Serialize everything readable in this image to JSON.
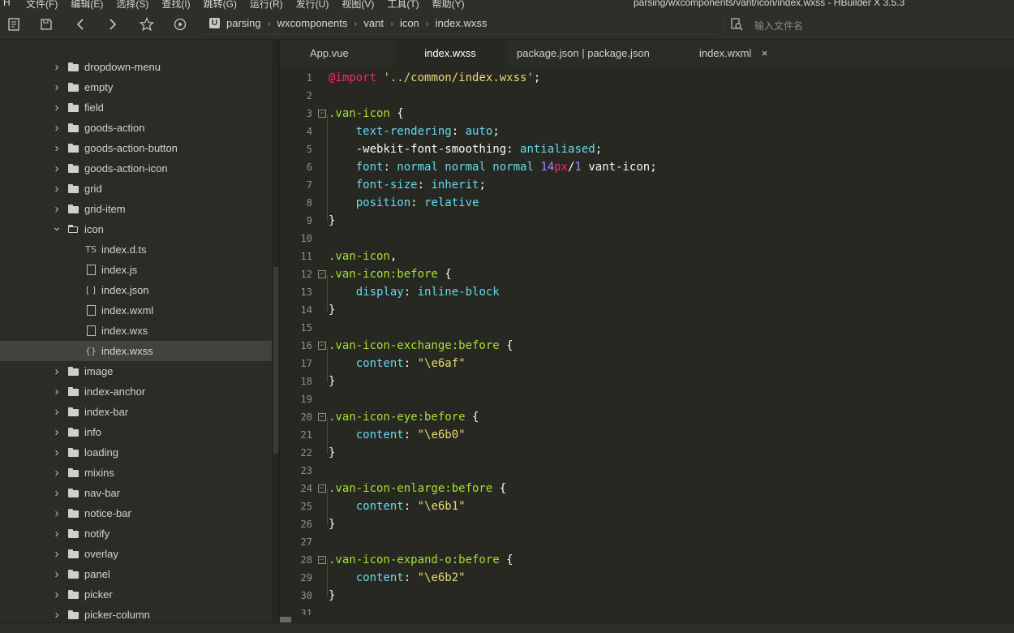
{
  "app": {
    "logo": "H",
    "window_title": "parsing/wxcomponents/vant/icon/index.wxss - HBuilder X 3.5.3",
    "menus": [
      "文件(F)",
      "编辑(E)",
      "选择(S)",
      "查找(I)",
      "跳转(G)",
      "运行(R)",
      "发行(U)",
      "视图(V)",
      "工具(T)",
      "帮助(Y)"
    ]
  },
  "toolbar": {
    "icons": [
      "new-file-icon",
      "save-icon",
      "back-icon",
      "forward-icon",
      "star-icon",
      "run-icon"
    ],
    "breadcrumb_badge": "U",
    "breadcrumb": [
      "parsing",
      "wxcomponents",
      "vant",
      "icon",
      "index.wxss"
    ],
    "search_placeholder": "输入文件名"
  },
  "sidebar": {
    "items": [
      {
        "label": "dropdown-menu",
        "kind": "folder"
      },
      {
        "label": "empty",
        "kind": "folder"
      },
      {
        "label": "field",
        "kind": "folder"
      },
      {
        "label": "goods-action",
        "kind": "folder"
      },
      {
        "label": "goods-action-button",
        "kind": "folder"
      },
      {
        "label": "goods-action-icon",
        "kind": "folder"
      },
      {
        "label": "grid",
        "kind": "folder"
      },
      {
        "label": "grid-item",
        "kind": "folder"
      },
      {
        "label": "icon",
        "kind": "folder-open"
      },
      {
        "label": "index.d.ts",
        "kind": "file",
        "icon": "TS"
      },
      {
        "label": "index.js",
        "kind": "file",
        "icon": "js"
      },
      {
        "label": "index.json",
        "kind": "file",
        "icon": "[ ]"
      },
      {
        "label": "index.wxml",
        "kind": "file",
        "icon": "doc"
      },
      {
        "label": "index.wxs",
        "kind": "file",
        "icon": "doc"
      },
      {
        "label": "index.wxss",
        "kind": "file",
        "icon": "{}",
        "selected": true
      },
      {
        "label": "image",
        "kind": "folder"
      },
      {
        "label": "index-anchor",
        "kind": "folder"
      },
      {
        "label": "index-bar",
        "kind": "folder"
      },
      {
        "label": "info",
        "kind": "folder"
      },
      {
        "label": "loading",
        "kind": "folder"
      },
      {
        "label": "mixins",
        "kind": "folder"
      },
      {
        "label": "nav-bar",
        "kind": "folder"
      },
      {
        "label": "notice-bar",
        "kind": "folder"
      },
      {
        "label": "notify",
        "kind": "folder"
      },
      {
        "label": "overlay",
        "kind": "folder"
      },
      {
        "label": "panel",
        "kind": "folder"
      },
      {
        "label": "picker",
        "kind": "folder"
      },
      {
        "label": "picker-column",
        "kind": "folder"
      }
    ]
  },
  "tabs": [
    {
      "label": "App.vue"
    },
    {
      "label": "index.wxss",
      "active": true
    },
    {
      "label": "package.json | package.json"
    },
    {
      "label": "index.wxml",
      "close": "×"
    }
  ],
  "editor": {
    "lines": [
      {
        "n": "1",
        "segs": [
          [
            "at",
            "@import"
          ],
          [
            "pun",
            " "
          ],
          [
            "str",
            "'../common/index.wxss'"
          ],
          [
            "pun",
            ";"
          ]
        ]
      },
      {
        "n": "2",
        "segs": []
      },
      {
        "n": "3",
        "fold": true,
        "segs": [
          [
            "sel",
            ".van-icon"
          ],
          [
            "pun",
            " {"
          ]
        ]
      },
      {
        "n": "4",
        "segs": [
          [
            "pun",
            "    "
          ],
          [
            "prop",
            "text-rendering"
          ],
          [
            "pun",
            ": "
          ],
          [
            "val",
            "auto"
          ],
          [
            "pun",
            ";"
          ]
        ]
      },
      {
        "n": "5",
        "segs": [
          [
            "pun",
            "    -webkit-font-smoothing: "
          ],
          [
            "val",
            "antialiased"
          ],
          [
            "pun",
            ";"
          ]
        ]
      },
      {
        "n": "6",
        "segs": [
          [
            "pun",
            "    "
          ],
          [
            "prop",
            "font"
          ],
          [
            "pun",
            ": "
          ],
          [
            "val",
            "normal normal normal "
          ],
          [
            "num",
            "14"
          ],
          [
            "unit",
            "px"
          ],
          [
            "pun",
            "/"
          ],
          [
            "num",
            "1"
          ],
          [
            "pun",
            " vant-icon;"
          ]
        ]
      },
      {
        "n": "7",
        "segs": [
          [
            "pun",
            "    "
          ],
          [
            "prop",
            "font-size"
          ],
          [
            "pun",
            ": "
          ],
          [
            "val",
            "inherit"
          ],
          [
            "pun",
            ";"
          ]
        ]
      },
      {
        "n": "8",
        "segs": [
          [
            "pun",
            "    "
          ],
          [
            "prop",
            "position"
          ],
          [
            "pun",
            ": "
          ],
          [
            "val",
            "relative"
          ]
        ]
      },
      {
        "n": "9",
        "segs": [
          [
            "pun",
            "}"
          ]
        ]
      },
      {
        "n": "10",
        "segs": []
      },
      {
        "n": "11",
        "segs": [
          [
            "sel",
            ".van-icon"
          ],
          [
            "pun",
            ","
          ]
        ]
      },
      {
        "n": "12",
        "fold": true,
        "segs": [
          [
            "sel",
            ".van-icon:before"
          ],
          [
            "pun",
            " {"
          ]
        ]
      },
      {
        "n": "13",
        "segs": [
          [
            "pun",
            "    "
          ],
          [
            "prop",
            "display"
          ],
          [
            "pun",
            ": "
          ],
          [
            "val",
            "inline-block"
          ]
        ]
      },
      {
        "n": "14",
        "segs": [
          [
            "pun",
            "}"
          ]
        ]
      },
      {
        "n": "15",
        "segs": []
      },
      {
        "n": "16",
        "fold": true,
        "segs": [
          [
            "sel",
            ".van-icon-exchange:before"
          ],
          [
            "pun",
            " {"
          ]
        ]
      },
      {
        "n": "17",
        "segs": [
          [
            "pun",
            "    "
          ],
          [
            "prop",
            "content"
          ],
          [
            "pun",
            ": "
          ],
          [
            "str",
            "\"\\e6af\""
          ]
        ]
      },
      {
        "n": "18",
        "segs": [
          [
            "pun",
            "}"
          ]
        ]
      },
      {
        "n": "19",
        "segs": []
      },
      {
        "n": "20",
        "fold": true,
        "segs": [
          [
            "sel",
            ".van-icon-eye:before"
          ],
          [
            "pun",
            " {"
          ]
        ]
      },
      {
        "n": "21",
        "segs": [
          [
            "pun",
            "    "
          ],
          [
            "prop",
            "content"
          ],
          [
            "pun",
            ": "
          ],
          [
            "str",
            "\"\\e6b0\""
          ]
        ]
      },
      {
        "n": "22",
        "segs": [
          [
            "pun",
            "}"
          ]
        ]
      },
      {
        "n": "23",
        "segs": []
      },
      {
        "n": "24",
        "fold": true,
        "segs": [
          [
            "sel",
            ".van-icon-enlarge:before"
          ],
          [
            "pun",
            " {"
          ]
        ]
      },
      {
        "n": "25",
        "segs": [
          [
            "pun",
            "    "
          ],
          [
            "prop",
            "content"
          ],
          [
            "pun",
            ": "
          ],
          [
            "str",
            "\"\\e6b1\""
          ]
        ]
      },
      {
        "n": "26",
        "segs": [
          [
            "pun",
            "}"
          ]
        ]
      },
      {
        "n": "27",
        "segs": []
      },
      {
        "n": "28",
        "fold": true,
        "segs": [
          [
            "sel",
            ".van-icon-expand-o:before"
          ],
          [
            "pun",
            " {"
          ]
        ]
      },
      {
        "n": "29",
        "segs": [
          [
            "pun",
            "    "
          ],
          [
            "prop",
            "content"
          ],
          [
            "pun",
            ": "
          ],
          [
            "str",
            "\"\\e6b2\""
          ]
        ]
      },
      {
        "n": "30",
        "segs": [
          [
            "pun",
            "}"
          ]
        ]
      },
      {
        "n": "31",
        "segs": []
      }
    ]
  }
}
